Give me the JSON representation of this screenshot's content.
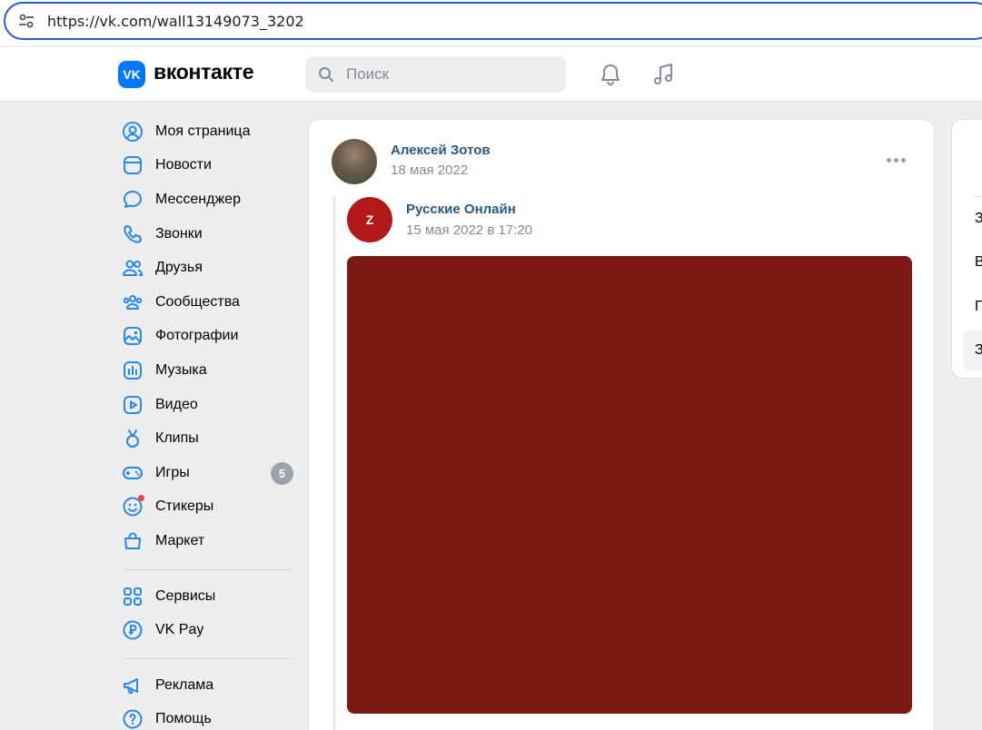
{
  "browser": {
    "url": "https://vk.com/wall13149073_3202"
  },
  "header": {
    "logo_mark": "VK",
    "logo_text": "вконтакте",
    "search_placeholder": "Поиск",
    "icons": [
      "bell-icon",
      "music-icon"
    ]
  },
  "sidebar": {
    "items": [
      {
        "label": "Моя страница",
        "icon": "profile-icon"
      },
      {
        "label": "Новости",
        "icon": "news-icon"
      },
      {
        "label": "Мессенджер",
        "icon": "messenger-icon"
      },
      {
        "label": "Звонки",
        "icon": "phone-icon"
      },
      {
        "label": "Друзья",
        "icon": "friends-icon"
      },
      {
        "label": "Сообщества",
        "icon": "communities-icon"
      },
      {
        "label": "Фотографии",
        "icon": "photos-icon"
      },
      {
        "label": "Музыка",
        "icon": "music-icon"
      },
      {
        "label": "Видео",
        "icon": "video-icon"
      },
      {
        "label": "Клипы",
        "icon": "clips-icon"
      },
      {
        "label": "Игры",
        "icon": "games-icon",
        "badge": "5"
      },
      {
        "label": "Стикеры",
        "icon": "stickers-icon"
      },
      {
        "label": "Маркет",
        "icon": "market-icon"
      }
    ],
    "secondary": [
      {
        "label": "Сервисы",
        "icon": "services-icon"
      },
      {
        "label": "VK Pay",
        "icon": "vkpay-icon"
      }
    ],
    "footer": [
      {
        "label": "Реклама",
        "icon": "ads-icon"
      },
      {
        "label": "Помощь",
        "icon": "help-icon"
      }
    ]
  },
  "post": {
    "author": "Алексей Зотов",
    "date": "18 мая 2022",
    "repost": {
      "source_name": "Русские Онлайн",
      "source_date": "15 мая 2022 в 17:20",
      "avatar_mark": "Z"
    }
  },
  "right_card": {
    "items": [
      "З",
      "В",
      "П",
      "З"
    ]
  }
}
